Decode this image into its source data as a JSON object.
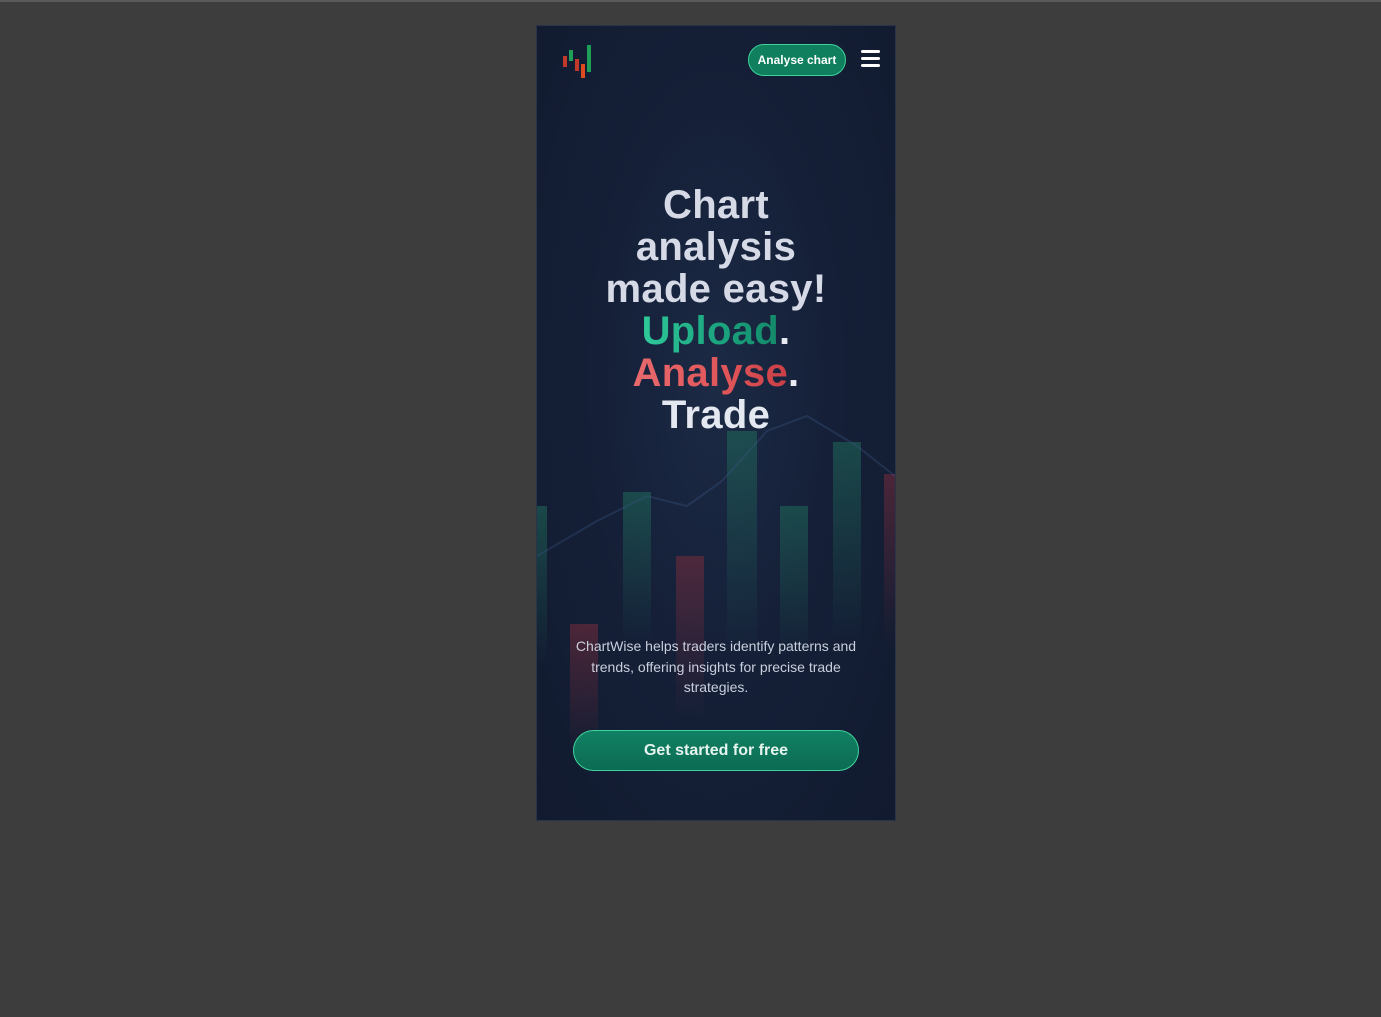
{
  "header": {
    "logo_icon": "candlestick-logo-icon",
    "analyse_button_label": "Analyse chart",
    "menu_icon": "hamburger-menu-icon"
  },
  "hero": {
    "line1": "Chart",
    "line2": "analysis",
    "line3": "made easy!",
    "upload": "Upload",
    "analyse": "Analyse",
    "trade": "Trade",
    "dot": "."
  },
  "description": "ChartWise helps traders identify patterns and trends, offering insights for precise trade strategies.",
  "cta_label": "Get started for free",
  "colors": {
    "accent_green": "#0f7f5e",
    "accent_green_border": "#3fd39c",
    "accent_red": "#e05559",
    "page_background": "#3d3d3d",
    "hero_background": "#152038"
  }
}
